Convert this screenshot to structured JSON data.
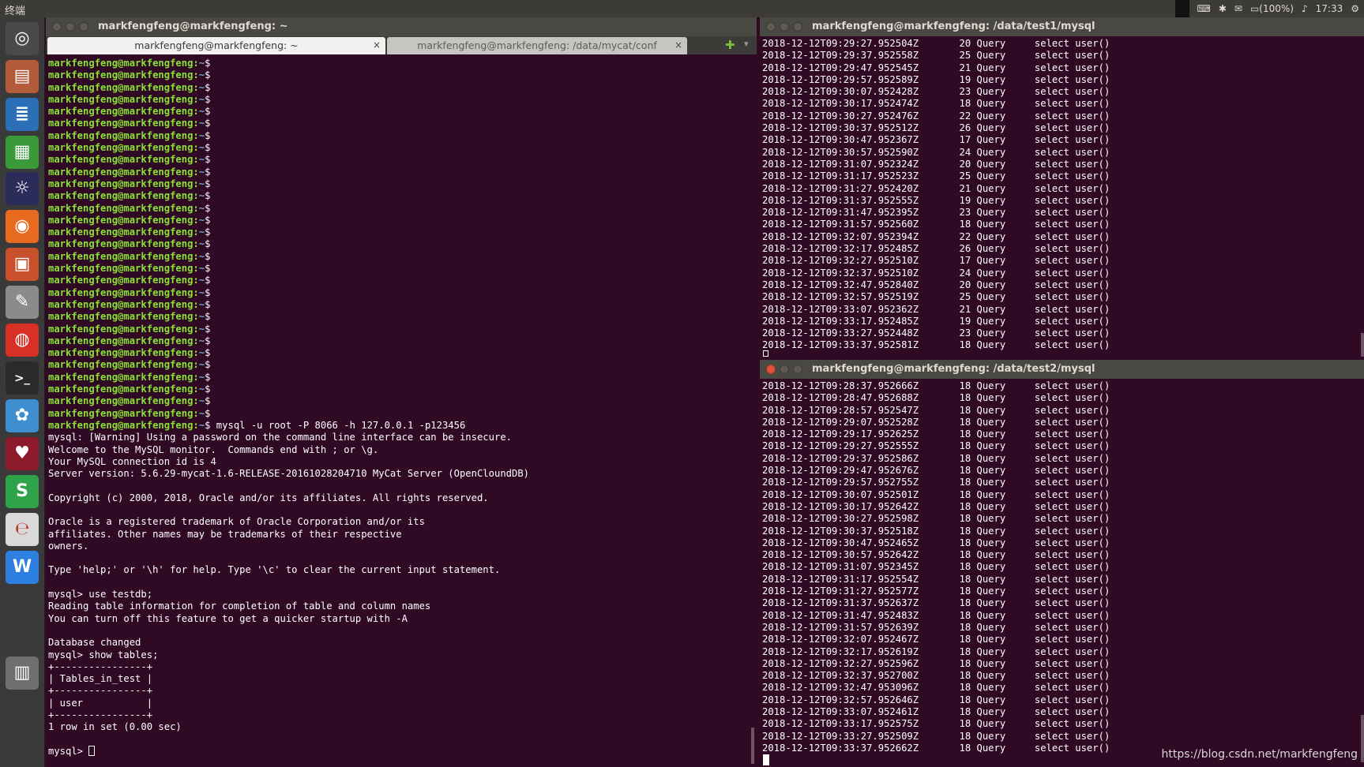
{
  "topbar": {
    "app_name": "终端",
    "battery": "(100%)",
    "time": "17:33"
  },
  "launcher": {
    "items": [
      {
        "icon": "dash-home-icon",
        "color": "#4a4a4a",
        "glyph": "◎"
      },
      {
        "icon": "files-icon",
        "color": "#b45b3c",
        "glyph": "▤"
      },
      {
        "icon": "writer-icon",
        "color": "#2a6fb8",
        "glyph": "≣"
      },
      {
        "icon": "calc-icon",
        "color": "#3a9a3a",
        "glyph": "▦"
      },
      {
        "icon": "eclipse-icon",
        "color": "#2c2c5a",
        "glyph": "☼"
      },
      {
        "icon": "firefox-icon",
        "color": "#e76a1e",
        "glyph": "◉"
      },
      {
        "icon": "impress-icon",
        "color": "#c8512b",
        "glyph": "▣"
      },
      {
        "icon": "text-editor-icon",
        "color": "#8b8b8b",
        "glyph": "✎"
      },
      {
        "icon": "chrome-icon",
        "color": "#d93025",
        "glyph": "◍"
      },
      {
        "icon": "terminal-icon",
        "color": "#2b2b2b",
        "glyph": ">_"
      },
      {
        "icon": "shotwell-icon",
        "color": "#3f8fd0",
        "glyph": "✿"
      },
      {
        "icon": "wine-icon",
        "color": "#8e1b2b",
        "glyph": "♥"
      },
      {
        "icon": "wps-sheets-icon",
        "color": "#2ea34a",
        "glyph": "S"
      },
      {
        "icon": "wps-pdf-icon",
        "color": "#d9d9d9",
        "glyph": "℮"
      },
      {
        "icon": "wps-writer-icon",
        "color": "#2d7fe0",
        "glyph": "W"
      },
      {
        "icon": "trash-icon",
        "color": "#6f6f6f",
        "glyph": "▥"
      }
    ]
  },
  "left_window": {
    "title": "markfengfeng@markfengfeng: ~",
    "tabs": [
      {
        "label": "markfengfeng@markfengfeng: ~",
        "close": "×"
      },
      {
        "label": "markfengfeng@markfengfeng: /data/mycat/conf",
        "close": "×"
      }
    ],
    "new_tab": "✚",
    "tab_menu": "▾",
    "prompt": "markfengfeng@markfengfeng:",
    "home_path": "~",
    "dollar": "$",
    "empty_prompt_count": 30,
    "command": " mysql -u root -P 8066 -h 127.0.0.1 -p123456",
    "output": [
      "mysql: [Warning] Using a password on the command line interface can be insecure.",
      "Welcome to the MySQL monitor.  Commands end with ; or \\g.",
      "Your MySQL connection id is 4",
      "Server version: 5.6.29-mycat-1.6-RELEASE-20161028204710 MyCat Server (OpenCloundDB)",
      "",
      "Copyright (c) 2000, 2018, Oracle and/or its affiliates. All rights reserved.",
      "",
      "Oracle is a registered trademark of Oracle Corporation and/or its",
      "affiliates. Other names may be trademarks of their respective",
      "owners.",
      "",
      "Type 'help;' or '\\h' for help. Type '\\c' to clear the current input statement.",
      "",
      "mysql> use testdb;",
      "Reading table information for completion of table and column names",
      "You can turn off this feature to get a quicker startup with -A",
      "",
      "Database changed",
      "mysql> show tables;",
      "+----------------+",
      "| Tables_in_test |",
      "+----------------+",
      "| user           |",
      "+----------------+",
      "1 row in set (0.00 sec)",
      ""
    ],
    "final_prompt": "mysql> "
  },
  "right_top_window": {
    "title": "markfengfeng@markfengfeng: /data/test1/mysql",
    "rows": [
      [
        "2018-12-12T09:29:27.952504Z",
        "20",
        "Query",
        "select user()"
      ],
      [
        "2018-12-12T09:29:37.952558Z",
        "25",
        "Query",
        "select user()"
      ],
      [
        "2018-12-12T09:29:47.952545Z",
        "21",
        "Query",
        "select user()"
      ],
      [
        "2018-12-12T09:29:57.952589Z",
        "19",
        "Query",
        "select user()"
      ],
      [
        "2018-12-12T09:30:07.952428Z",
        "23",
        "Query",
        "select user()"
      ],
      [
        "2018-12-12T09:30:17.952474Z",
        "18",
        "Query",
        "select user()"
      ],
      [
        "2018-12-12T09:30:27.952476Z",
        "22",
        "Query",
        "select user()"
      ],
      [
        "2018-12-12T09:30:37.952512Z",
        "26",
        "Query",
        "select user()"
      ],
      [
        "2018-12-12T09:30:47.952367Z",
        "17",
        "Query",
        "select user()"
      ],
      [
        "2018-12-12T09:30:57.952590Z",
        "24",
        "Query",
        "select user()"
      ],
      [
        "2018-12-12T09:31:07.952324Z",
        "20",
        "Query",
        "select user()"
      ],
      [
        "2018-12-12T09:31:17.952523Z",
        "25",
        "Query",
        "select user()"
      ],
      [
        "2018-12-12T09:31:27.952420Z",
        "21",
        "Query",
        "select user()"
      ],
      [
        "2018-12-12T09:31:37.952555Z",
        "19",
        "Query",
        "select user()"
      ],
      [
        "2018-12-12T09:31:47.952395Z",
        "23",
        "Query",
        "select user()"
      ],
      [
        "2018-12-12T09:31:57.952560Z",
        "18",
        "Query",
        "select user()"
      ],
      [
        "2018-12-12T09:32:07.952394Z",
        "22",
        "Query",
        "select user()"
      ],
      [
        "2018-12-12T09:32:17.952485Z",
        "26",
        "Query",
        "select user()"
      ],
      [
        "2018-12-12T09:32:27.952510Z",
        "17",
        "Query",
        "select user()"
      ],
      [
        "2018-12-12T09:32:37.952510Z",
        "24",
        "Query",
        "select user()"
      ],
      [
        "2018-12-12T09:32:47.952840Z",
        "20",
        "Query",
        "select user()"
      ],
      [
        "2018-12-12T09:32:57.952519Z",
        "25",
        "Query",
        "select user()"
      ],
      [
        "2018-12-12T09:33:07.952362Z",
        "21",
        "Query",
        "select user()"
      ],
      [
        "2018-12-12T09:33:17.952485Z",
        "19",
        "Query",
        "select user()"
      ],
      [
        "2018-12-12T09:33:27.952448Z",
        "23",
        "Query",
        "select user()"
      ],
      [
        "2018-12-12T09:33:37.952581Z",
        "18",
        "Query",
        "select user()"
      ]
    ]
  },
  "right_bottom_window": {
    "title": "markfengfeng@markfengfeng: /data/test2/mysql",
    "rows": [
      [
        "2018-12-12T09:28:37.952666Z",
        "18",
        "Query",
        "select user()"
      ],
      [
        "2018-12-12T09:28:47.952688Z",
        "18",
        "Query",
        "select user()"
      ],
      [
        "2018-12-12T09:28:57.952547Z",
        "18",
        "Query",
        "select user()"
      ],
      [
        "2018-12-12T09:29:07.952528Z",
        "18",
        "Query",
        "select user()"
      ],
      [
        "2018-12-12T09:29:17.952625Z",
        "18",
        "Query",
        "select user()"
      ],
      [
        "2018-12-12T09:29:27.952555Z",
        "18",
        "Query",
        "select user()"
      ],
      [
        "2018-12-12T09:29:37.952586Z",
        "18",
        "Query",
        "select user()"
      ],
      [
        "2018-12-12T09:29:47.952676Z",
        "18",
        "Query",
        "select user()"
      ],
      [
        "2018-12-12T09:29:57.952755Z",
        "18",
        "Query",
        "select user()"
      ],
      [
        "2018-12-12T09:30:07.952501Z",
        "18",
        "Query",
        "select user()"
      ],
      [
        "2018-12-12T09:30:17.952642Z",
        "18",
        "Query",
        "select user()"
      ],
      [
        "2018-12-12T09:30:27.952598Z",
        "18",
        "Query",
        "select user()"
      ],
      [
        "2018-12-12T09:30:37.952518Z",
        "18",
        "Query",
        "select user()"
      ],
      [
        "2018-12-12T09:30:47.952465Z",
        "18",
        "Query",
        "select user()"
      ],
      [
        "2018-12-12T09:30:57.952642Z",
        "18",
        "Query",
        "select user()"
      ],
      [
        "2018-12-12T09:31:07.952345Z",
        "18",
        "Query",
        "select user()"
      ],
      [
        "2018-12-12T09:31:17.952554Z",
        "18",
        "Query",
        "select user()"
      ],
      [
        "2018-12-12T09:31:27.952577Z",
        "18",
        "Query",
        "select user()"
      ],
      [
        "2018-12-12T09:31:37.952637Z",
        "18",
        "Query",
        "select user()"
      ],
      [
        "2018-12-12T09:31:47.952483Z",
        "18",
        "Query",
        "select user()"
      ],
      [
        "2018-12-12T09:31:57.952639Z",
        "18",
        "Query",
        "select user()"
      ],
      [
        "2018-12-12T09:32:07.952467Z",
        "18",
        "Query",
        "select user()"
      ],
      [
        "2018-12-12T09:32:17.952619Z",
        "18",
        "Query",
        "select user()"
      ],
      [
        "2018-12-12T09:32:27.952596Z",
        "18",
        "Query",
        "select user()"
      ],
      [
        "2018-12-12T09:32:37.952700Z",
        "18",
        "Query",
        "select user()"
      ],
      [
        "2018-12-12T09:32:47.953096Z",
        "18",
        "Query",
        "select user()"
      ],
      [
        "2018-12-12T09:32:57.952646Z",
        "18",
        "Query",
        "select user()"
      ],
      [
        "2018-12-12T09:33:07.952461Z",
        "18",
        "Query",
        "select user()"
      ],
      [
        "2018-12-12T09:33:17.952575Z",
        "18",
        "Query",
        "select user()"
      ],
      [
        "2018-12-12T09:33:27.952509Z",
        "18",
        "Query",
        "select user()"
      ],
      [
        "2018-12-12T09:33:37.952662Z",
        "18",
        "Query",
        "select user()"
      ]
    ]
  },
  "watermark": "https://blog.csdn.net/markfengfeng",
  "colors": {
    "terminal_bg": "#300a24",
    "prompt_green": "#8ae234",
    "path_blue": "#729fcf",
    "text": "#ffffff"
  }
}
